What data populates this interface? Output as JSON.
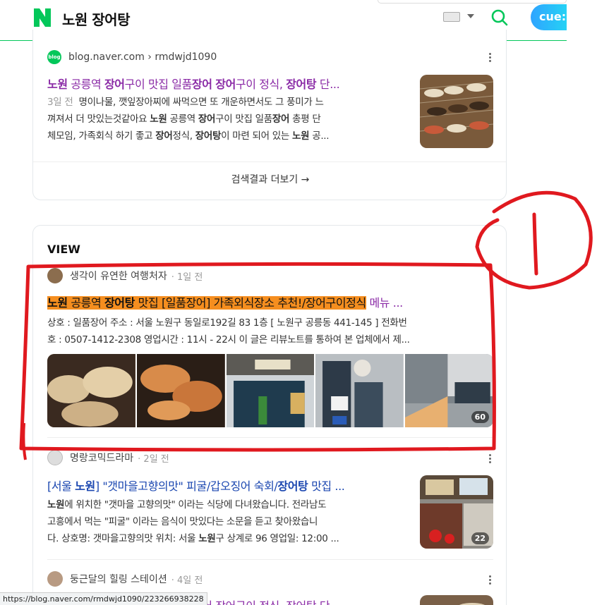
{
  "header": {
    "query": "노원 장어탕",
    "cue_label": "cue:"
  },
  "result1": {
    "source": "blog.naver.com › rmdwjd1090",
    "blog_icon_text": "blog",
    "title_parts": [
      "노원",
      " 공릉역 ",
      "장어",
      "구이 맛집 일품",
      "장어",
      " ",
      "장어",
      "구이 정식, ",
      "장어탕",
      " 단..."
    ],
    "date": "3일 전",
    "desc_line1": "명이나물, 깻잎장아찌에 싸먹으면 또 개운하면서도 그 풍미가 느",
    "desc_line2_parts": [
      "껴져서 더 맛있는것같아요 ",
      "노원",
      " 공릉역 ",
      "장어",
      "구이 맛집 일품",
      "장어",
      " 총평 단"
    ],
    "desc_line3_parts": [
      "체모임, 가족회식 하기 좋고 ",
      "장어",
      "정식, ",
      "장어탕",
      "이 마련 되어 있는 ",
      "노원",
      " 공..."
    ],
    "more_label": "검색결과 더보기 →"
  },
  "view": {
    "heading": "VIEW",
    "post1": {
      "author": "생각이 유연한 여행처자",
      "time": "· 1일 전",
      "title_hl_parts": [
        "노원",
        " 공릉역 ",
        "장어탕",
        " 맛집 [일품장어] 가족외식장소 추천!/장어구이정식"
      ],
      "title_tail": " 메뉴 ...",
      "desc_line1": "상호 : 일품장어 주소 : 서울 노원구 동일로192길 83 1층 [ 노원구 공릉동 441-145 ] 전화번",
      "desc_line2": "호 : 0507-1412-2308 영업시간 : 11시 - 22시 이 글은 리뷰노트를 통하여 본 업체에서 제...",
      "photo_count": "60"
    },
    "post2": {
      "author": "명랑코믹드라마",
      "time": "· 2일 전",
      "title_parts": [
        "[서울 ",
        "노원",
        "] \"갯마을고향의맛\" 피굴/갑오징어 숙회/",
        "장어탕",
        " 맛집 ..."
      ],
      "desc_line1_parts": [
        "노원",
        "에 위치한 \"갯마을 고향의맛\" 이라는 식당에 다녀왔습니다. 전라남도"
      ],
      "desc_line2": "고흥에서 먹는 \"피굴\" 이라는 음식이 맛있다는 소문을 듣고 찾아왔습니",
      "desc_line3_parts": [
        "다. 상호명: 갯마을고향의맛 위치: 서울 ",
        "노원",
        "구 상계로 96 영업일: 12:00 ..."
      ],
      "photo_count": "22"
    },
    "post3": {
      "author": "둥근달의 힐링 스테이션",
      "time": "· 4일 전",
      "title_visible": "노원 공릉역 장어구이 맛집 일품장어 장어구이 정식, 장어탕 단..."
    }
  },
  "status_bar": {
    "url": "https://blog.naver.com/rmdwjd1090/223266938228"
  },
  "annotation": {
    "label": "1",
    "color": "#e0191f"
  }
}
